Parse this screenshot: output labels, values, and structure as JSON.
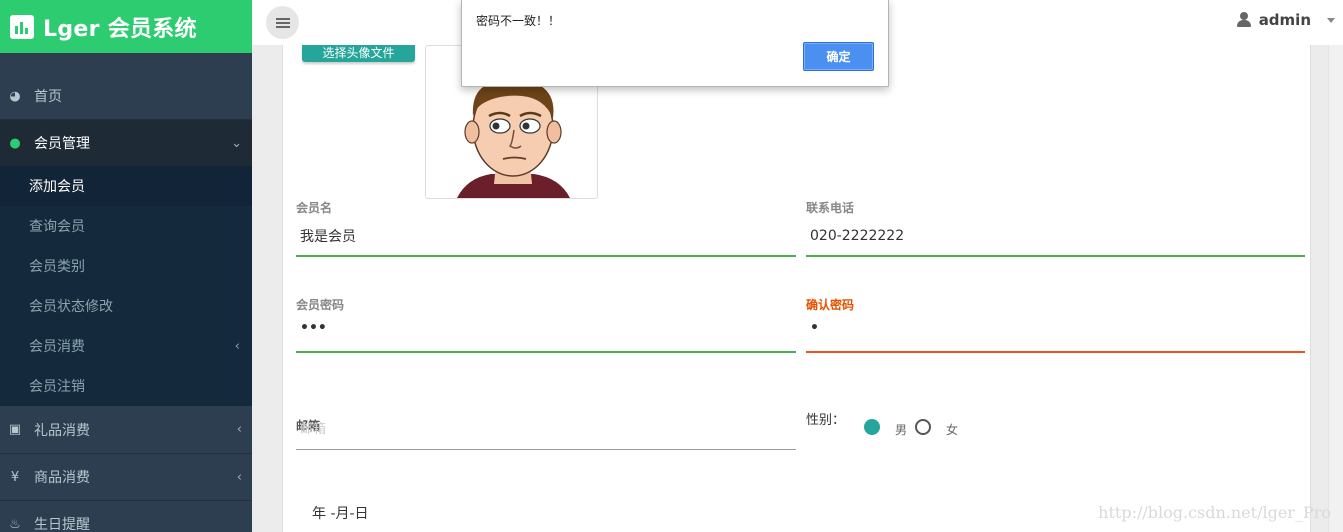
{
  "brand": {
    "title": "Lger 会员系统",
    "color": "#2ecc71"
  },
  "header": {
    "user_name": "admin"
  },
  "sidebar": {
    "items": [
      {
        "label": "首页",
        "icon": "dashboard-icon"
      },
      {
        "label": "会员管理",
        "icon": "user-icon"
      },
      {
        "label": "礼品消费",
        "icon": "gift-icon"
      },
      {
        "label": "商品消费",
        "icon": "yen-icon"
      },
      {
        "label": "生日提醒",
        "icon": "cake-icon"
      }
    ],
    "submenu": [
      {
        "label": "添加会员"
      },
      {
        "label": "查询会员"
      },
      {
        "label": "会员类别"
      },
      {
        "label": "会员状态修改"
      },
      {
        "label": "会员消费"
      },
      {
        "label": "会员注销"
      }
    ]
  },
  "form": {
    "upload_button": "选择头像文件",
    "member_name": {
      "label": "会员名",
      "value": "我是会员"
    },
    "phone": {
      "label": "联系电话",
      "value": "020-2222222"
    },
    "password": {
      "label": "会员密码",
      "value": "•••"
    },
    "confirm_password": {
      "label": "确认密码",
      "value": "•"
    },
    "email": {
      "label": "邮箱",
      "placeholder": "邮箱"
    },
    "gender": {
      "label": "性别：",
      "options": [
        "男",
        "女"
      ],
      "selected": "男"
    },
    "birthday": {
      "value": "年 -月-日"
    }
  },
  "alert": {
    "message": "密码不一致！！",
    "ok_label": "确定"
  },
  "watermark": "http://blog.csdn.net/lger_Pro"
}
